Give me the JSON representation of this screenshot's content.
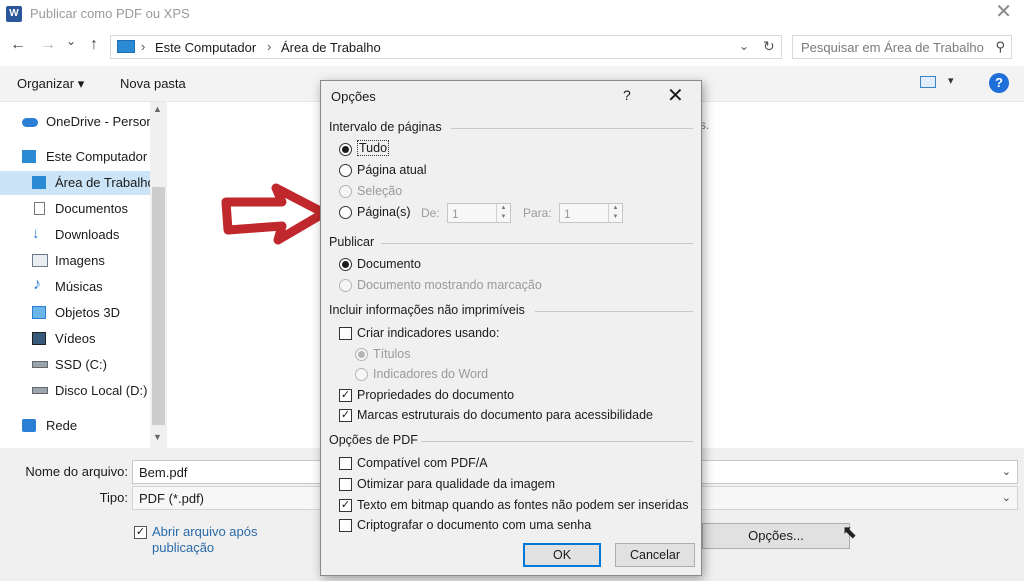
{
  "window": {
    "app_icon": "W",
    "title": "Publicar como PDF ou XPS",
    "close": "✕"
  },
  "nav": {
    "back": "←",
    "forward": "→",
    "dropdown": "⌄",
    "up": "↑",
    "breadcrumb": [
      "Este Computador",
      "Área de Trabalho"
    ],
    "search_placeholder": "Pesquisar em Área de Trabalho"
  },
  "toolbar": {
    "organize": "Organizar ▾",
    "new_folder": "Nova pasta",
    "help": "?"
  },
  "sidebar": {
    "items": [
      {
        "label": "OneDrive - Person",
        "icon": "cloud-icon"
      },
      {
        "label": "Este Computador",
        "icon": "computer-icon"
      },
      {
        "label": "Área de Trabalho",
        "icon": "desktop-icon",
        "selected": true
      },
      {
        "label": "Documentos",
        "icon": "documents-icon"
      },
      {
        "label": "Downloads",
        "icon": "downloads-icon"
      },
      {
        "label": "Imagens",
        "icon": "images-icon"
      },
      {
        "label": "Músicas",
        "icon": "music-icon"
      },
      {
        "label": "Objetos 3D",
        "icon": "objects3d-icon"
      },
      {
        "label": "Vídeos",
        "icon": "videos-icon"
      },
      {
        "label": "SSD (C:)",
        "icon": "drive-icon"
      },
      {
        "label": "Disco Local (D:)",
        "icon": "drive-icon"
      },
      {
        "label": "Rede",
        "icon": "network-icon"
      }
    ]
  },
  "bottom": {
    "filename_label": "Nome do arquivo:",
    "filename_value": "Bem.pdf",
    "type_label": "Tipo:",
    "type_value": "PDF (*.pdf)",
    "open_after_label": "Abrir arquivo após publicação",
    "open_after_checked": true,
    "options_button": "Opções..."
  },
  "dialog": {
    "title": "Opções",
    "help": "?",
    "close": "✕",
    "page_range": {
      "header": "Intervalo de páginas",
      "all": "Tudo",
      "current": "Página atual",
      "selection": "Seleção",
      "pages": "Página(s)",
      "from_label": "De:",
      "from_value": "1",
      "to_label": "Para:",
      "to_value": "1",
      "selected": "Tudo"
    },
    "publish": {
      "header": "Publicar",
      "document": "Documento",
      "document_markup": "Documento mostrando marcação",
      "selected": "Documento"
    },
    "non_printing": {
      "header": "Incluir informações não imprimíveis",
      "create_bookmarks": "Criar indicadores usando:",
      "create_bookmarks_checked": false,
      "headings": "Títulos",
      "word_bookmarks": "Indicadores do Word",
      "doc_properties": "Propriedades do documento",
      "doc_properties_checked": true,
      "structure_tags": "Marcas estruturais do documento para acessibilidade",
      "structure_tags_checked": true
    },
    "pdf_options": {
      "header": "Opções de PDF",
      "pdfa": "Compatível com PDF/A",
      "pdfa_checked": false,
      "optimize": "Otimizar para qualidade da imagem",
      "optimize_checked": false,
      "bitmap_text": "Texto em bitmap quando as fontes não podem ser inseridas",
      "bitmap_text_checked": true,
      "encrypt": "Criptografar o documento com uma senha",
      "encrypt_checked": false
    },
    "ok": "OK",
    "cancel": "Cancelar"
  },
  "annotation_color": "#c0282d",
  "accent": "#0078d7"
}
